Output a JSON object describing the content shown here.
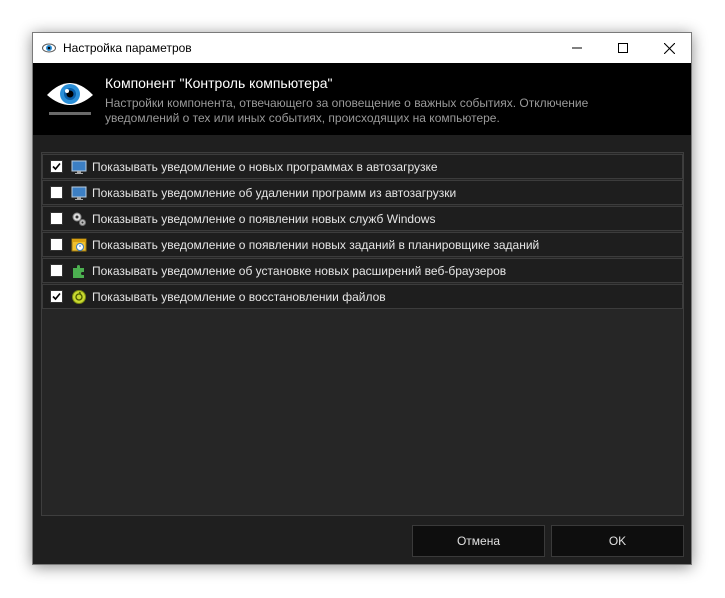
{
  "window": {
    "title": "Настройка параметров",
    "icon": "eye-icon"
  },
  "header": {
    "title": "Компонент \"Контроль компьютера\"",
    "description": "Настройки компонента, отвечающего за оповещение о важных событиях. Отключение уведомлений о тех или иных событиях, происходящих на компьютере."
  },
  "options": [
    {
      "label": "Показывать уведомление о новых программах в автозагрузке",
      "checked": true,
      "icon": "monitor-icon"
    },
    {
      "label": "Показывать уведомление об удалении программ из автозагрузки",
      "checked": false,
      "icon": "monitor-icon"
    },
    {
      "label": "Показывать уведомление о появлении новых служб Windows",
      "checked": false,
      "icon": "gears-icon"
    },
    {
      "label": "Показывать уведомление о появлении новых заданий в планировщике заданий",
      "checked": false,
      "icon": "scheduler-icon"
    },
    {
      "label": "Показывать уведомление об установке новых расширений веб-браузеров",
      "checked": false,
      "icon": "puzzle-icon"
    },
    {
      "label": "Показывать уведомление о восстановлении файлов",
      "checked": true,
      "icon": "restore-icon"
    }
  ],
  "buttons": {
    "cancel": "Отмена",
    "ok": "OK"
  },
  "colors": {
    "background": "#1f1f1f",
    "header": "#000000",
    "accent_eye": "#2a8fd8"
  }
}
